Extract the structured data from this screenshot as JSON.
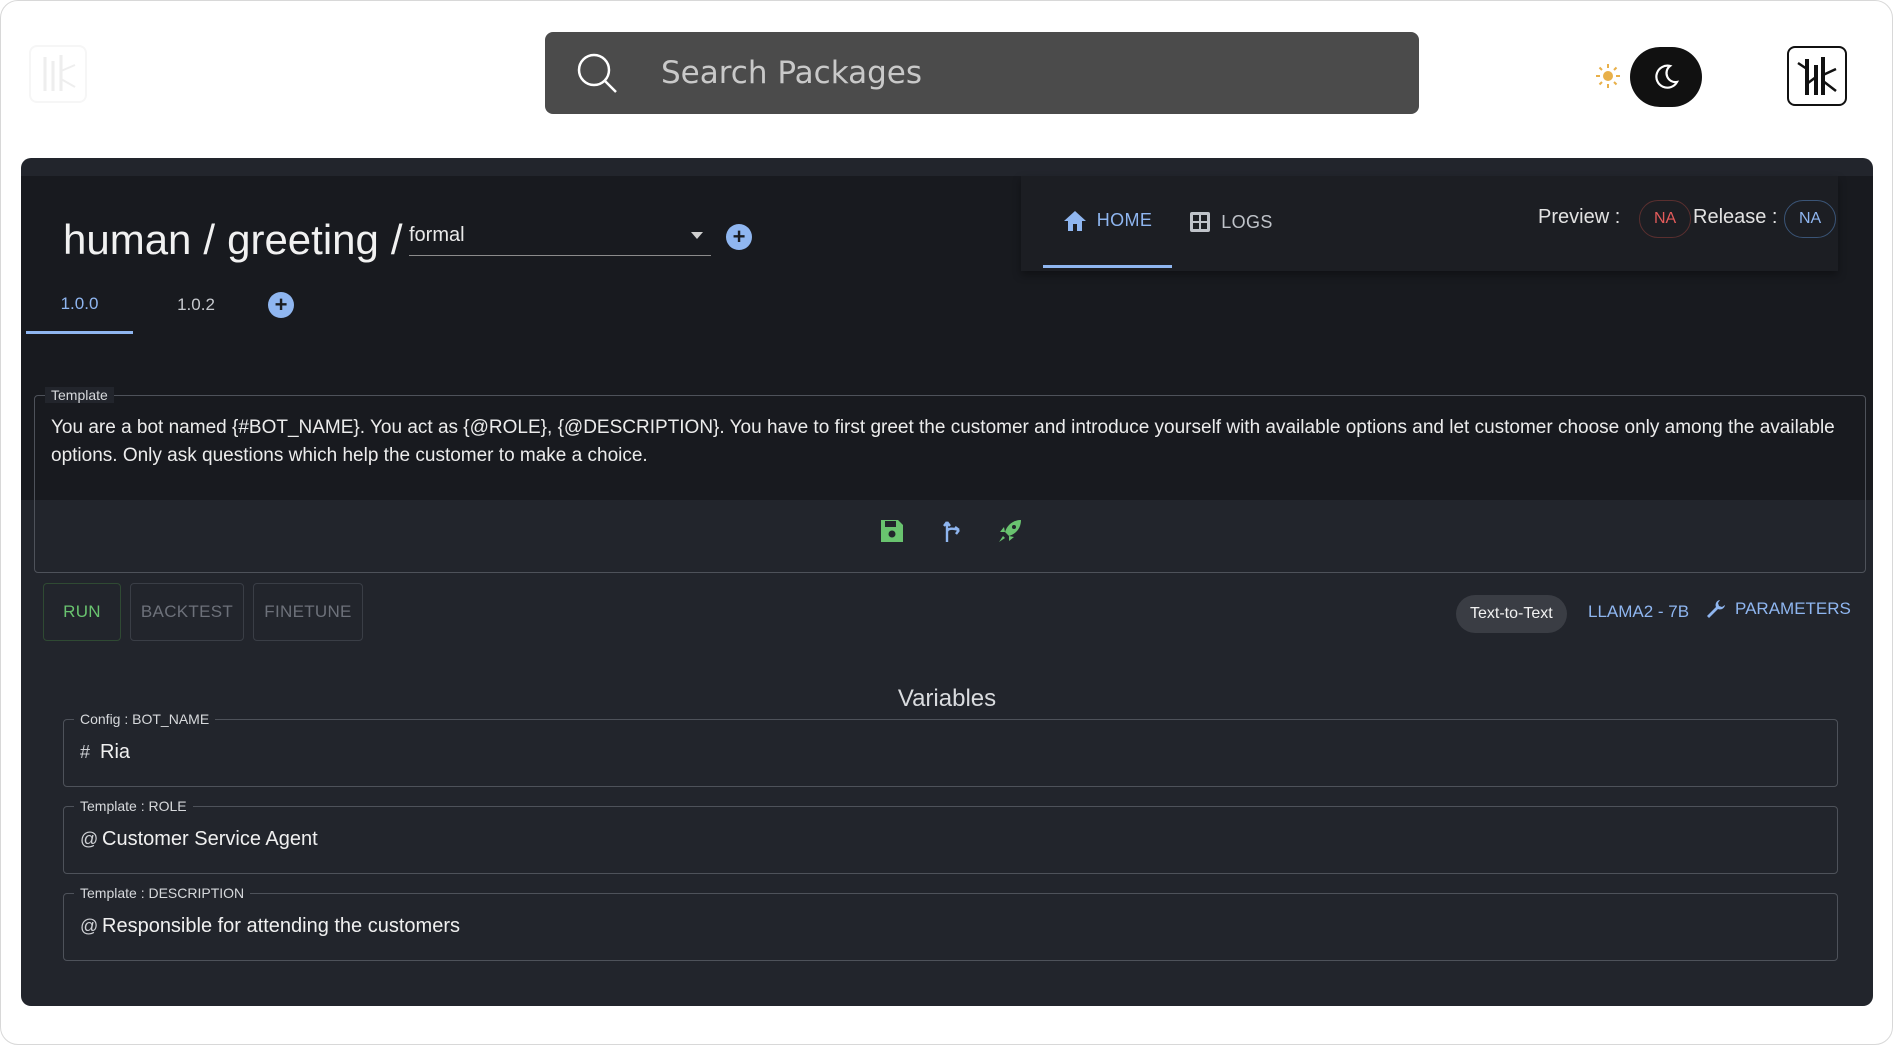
{
  "search": {
    "placeholder": "Search Packages"
  },
  "breadcrumb": {
    "part1": "human",
    "sep1": "/",
    "part2": "greeting",
    "sep2": "/"
  },
  "variant_select": {
    "value": "formal"
  },
  "nav": {
    "home_label": "HOME",
    "logs_label": "LOGS"
  },
  "status": {
    "preview_label": "Preview :",
    "preview_value": "NA",
    "release_label": "Release :",
    "release_value": "NA"
  },
  "versions": [
    "1.0.0",
    "1.0.2"
  ],
  "active_version": "1.0.0",
  "template": {
    "label": "Template",
    "text": "You are a bot named {#BOT_NAME}. You act as {@ROLE}, {@DESCRIPTION}. You have to first greet the customer and introduce yourself with available options and let customer choose only among the available options. Only ask questions which help the customer to make a choice."
  },
  "actions": {
    "run": "RUN",
    "backtest": "BACKTEST",
    "finetune": "FINETUNE"
  },
  "model": {
    "mode_chip": "Text-to-Text",
    "name": "LLAMA2 - 7B",
    "params_label": "PARAMETERS"
  },
  "variables": {
    "title": "Variables",
    "items": [
      {
        "label": "Config : BOT_NAME",
        "prefix": "#",
        "value": "Ria"
      },
      {
        "label": "Template : ROLE",
        "prefix": "@",
        "value": "Customer Service Agent"
      },
      {
        "label": "Template : DESCRIPTION",
        "prefix": "@",
        "value": "Responsible for attending the customers"
      }
    ]
  },
  "colors": {
    "accent": "#8fb6f0",
    "run_green": "#69c36f",
    "na_red": "#e35b5b",
    "panel_bg": "#22252c",
    "header_bg": "#181a1f"
  },
  "icons": [
    "search-icon",
    "sun-icon",
    "moon-icon",
    "logo-icon",
    "plus-circle-icon",
    "home-icon",
    "logs-grid-icon",
    "save-icon",
    "branch-icon",
    "rocket-icon",
    "wrench-icon",
    "caret-down-icon"
  ]
}
